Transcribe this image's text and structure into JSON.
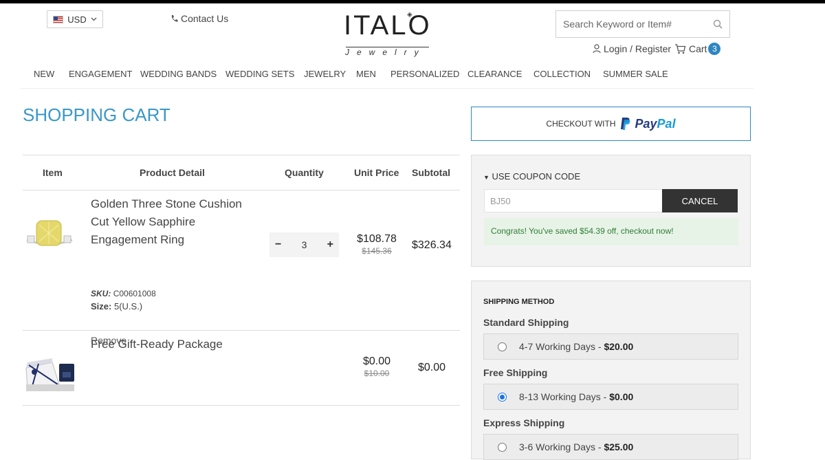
{
  "header": {
    "currency": "USD",
    "contact": "Contact Us",
    "logo_word": "ITALO",
    "logo_sub": "Jewelry",
    "search_placeholder": "Search Keyword or Item#",
    "login": "Login / Register",
    "cart_label": "Cart",
    "cart_count": "3"
  },
  "nav": [
    "NEW",
    "ENGAGEMENT",
    "WEDDING BANDS",
    "WEDDING SETS",
    "JEWELRY",
    "MEN",
    "PERSONALIZED",
    "CLEARANCE",
    "COLLECTION",
    "SUMMER SALE"
  ],
  "cart": {
    "title": "SHOPPING CART",
    "headers": {
      "item": "Item",
      "detail": "Product Detail",
      "quantity": "Quantity",
      "unit_price": "Unit Price",
      "subtotal": "Subtotal"
    },
    "items": [
      {
        "name_lines": [
          "Golden Three Stone Cushion",
          "Cut Yellow Sapphire",
          "Engagement Ring"
        ],
        "sku_label": "SKU:",
        "sku": "C00601008",
        "size_label": "Size:",
        "size": "5(U.S.)",
        "quantity": "3",
        "price": "$108.78",
        "old_price": "$145.36",
        "subtotal": "$326.34",
        "remove": "Remove"
      },
      {
        "name": "Free Gift-Ready Package",
        "price": "$0.00",
        "old_price": "$10.00",
        "subtotal": "$0.00"
      }
    ]
  },
  "paypal": {
    "prefix": "CHECKOUT WITH",
    "pay": "Pay",
    "pal": "Pal"
  },
  "coupon": {
    "label": "USE COUPON CODE",
    "code": "BJ50",
    "cancel": "CANCEL",
    "message": "Congrats! You've saved $54.39 off, checkout now!"
  },
  "shipping": {
    "title": "SHIPPING METHOD",
    "groups": [
      {
        "name": "Standard Shipping",
        "days": "4-7 Working Days - ",
        "cost": "$20.00",
        "selected": false
      },
      {
        "name": "Free Shipping",
        "days": "8-13 Working Days - ",
        "cost": "$0.00",
        "selected": true
      },
      {
        "name": "Express Shipping",
        "days": "3-6 Working Days - ",
        "cost": "$25.00",
        "selected": false
      }
    ]
  },
  "colors": {
    "accent": "#3a97c8",
    "badge": "#2e86c1",
    "success_bg": "#e8f3e8",
    "success_text": "#2e7d32"
  }
}
